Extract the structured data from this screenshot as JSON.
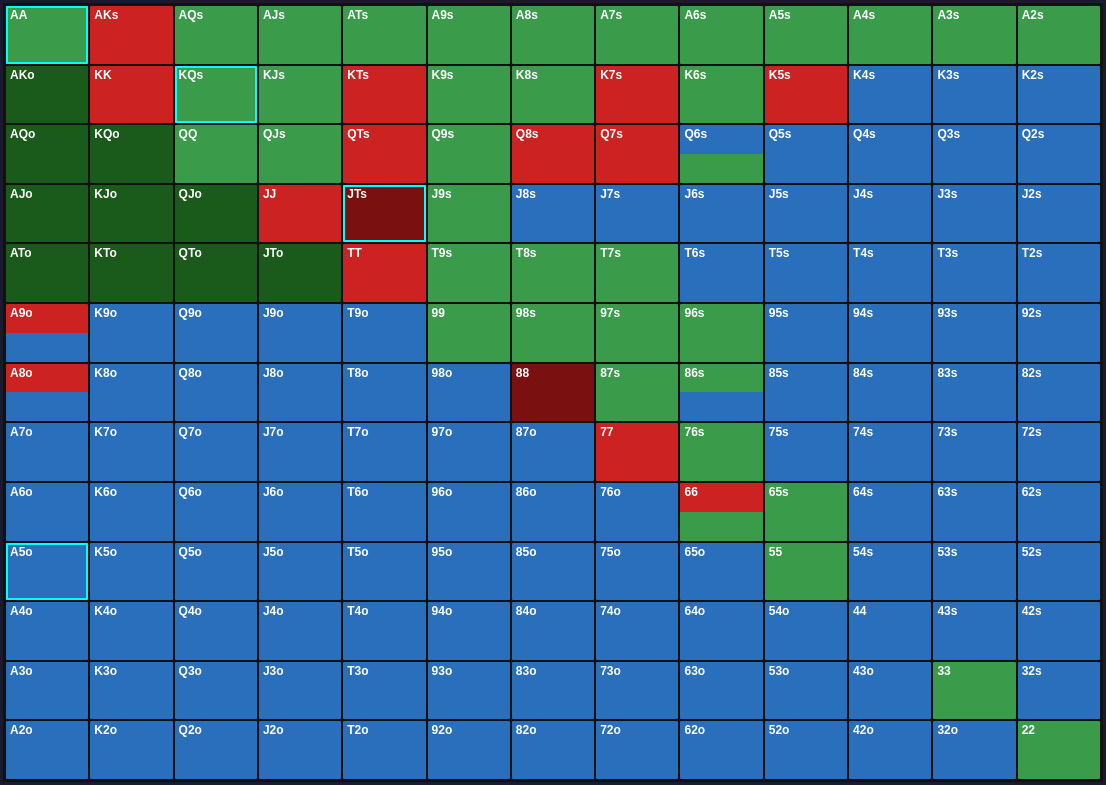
{
  "grid": {
    "cells": [
      {
        "label": "AA",
        "color": "green",
        "border": "cyan"
      },
      {
        "label": "AKs",
        "color": "red",
        "border": ""
      },
      {
        "label": "AQs",
        "color": "green",
        "border": ""
      },
      {
        "label": "AJs",
        "color": "green",
        "border": ""
      },
      {
        "label": "ATs",
        "color": "green",
        "border": ""
      },
      {
        "label": "A9s",
        "color": "green",
        "border": ""
      },
      {
        "label": "A8s",
        "color": "green",
        "border": ""
      },
      {
        "label": "A7s",
        "color": "green",
        "border": ""
      },
      {
        "label": "A6s",
        "color": "green",
        "border": ""
      },
      {
        "label": "A5s",
        "color": "green",
        "border": ""
      },
      {
        "label": "A4s",
        "color": "green",
        "border": ""
      },
      {
        "label": "A3s",
        "color": "green",
        "border": ""
      },
      {
        "label": "A2s",
        "color": "green",
        "border": ""
      },
      {
        "label": "AKo",
        "color": "dark-green",
        "border": ""
      },
      {
        "label": "KK",
        "color": "red",
        "border": ""
      },
      {
        "label": "KQs",
        "color": "green",
        "border": "cyan"
      },
      {
        "label": "KJs",
        "color": "green",
        "border": ""
      },
      {
        "label": "KTs",
        "color": "red",
        "border": ""
      },
      {
        "label": "K9s",
        "color": "green",
        "border": ""
      },
      {
        "label": "K8s",
        "color": "green",
        "border": ""
      },
      {
        "label": "K7s",
        "color": "red",
        "border": ""
      },
      {
        "label": "K6s",
        "color": "green",
        "border": ""
      },
      {
        "label": "K5s",
        "color": "red",
        "border": ""
      },
      {
        "label": "K4s",
        "color": "blue",
        "border": ""
      },
      {
        "label": "K3s",
        "color": "blue",
        "border": ""
      },
      {
        "label": "K2s",
        "color": "blue",
        "border": ""
      },
      {
        "label": "AQo",
        "color": "dark-green",
        "border": ""
      },
      {
        "label": "KQo",
        "color": "dark-green",
        "border": ""
      },
      {
        "label": "QQ",
        "color": "green",
        "border": ""
      },
      {
        "label": "QJs",
        "color": "green",
        "border": ""
      },
      {
        "label": "QTs",
        "color": "red",
        "border": ""
      },
      {
        "label": "Q9s",
        "color": "green",
        "border": ""
      },
      {
        "label": "Q8s",
        "color": "red",
        "border": ""
      },
      {
        "label": "Q7s",
        "color": "red",
        "border": ""
      },
      {
        "label": "Q6s",
        "color": "split-blue-green",
        "border": ""
      },
      {
        "label": "Q5s",
        "color": "blue",
        "border": ""
      },
      {
        "label": "Q4s",
        "color": "blue",
        "border": ""
      },
      {
        "label": "Q3s",
        "color": "blue",
        "border": ""
      },
      {
        "label": "Q2s",
        "color": "blue",
        "border": ""
      },
      {
        "label": "AJo",
        "color": "dark-green",
        "border": ""
      },
      {
        "label": "KJo",
        "color": "dark-green",
        "border": ""
      },
      {
        "label": "QJo",
        "color": "dark-green",
        "border": ""
      },
      {
        "label": "JJ",
        "color": "red",
        "border": ""
      },
      {
        "label": "JTs",
        "color": "dark-red",
        "border": "cyan"
      },
      {
        "label": "J9s",
        "color": "green",
        "border": ""
      },
      {
        "label": "J8s",
        "color": "blue",
        "border": ""
      },
      {
        "label": "J7s",
        "color": "blue",
        "border": ""
      },
      {
        "label": "J6s",
        "color": "blue",
        "border": ""
      },
      {
        "label": "J5s",
        "color": "blue",
        "border": ""
      },
      {
        "label": "J4s",
        "color": "blue",
        "border": ""
      },
      {
        "label": "J3s",
        "color": "blue",
        "border": ""
      },
      {
        "label": "J2s",
        "color": "blue",
        "border": ""
      },
      {
        "label": "ATo",
        "color": "dark-green",
        "border": ""
      },
      {
        "label": "KTo",
        "color": "dark-green",
        "border": ""
      },
      {
        "label": "QTo",
        "color": "dark-green",
        "border": ""
      },
      {
        "label": "JTo",
        "color": "dark-green",
        "border": ""
      },
      {
        "label": "TT",
        "color": "red",
        "border": ""
      },
      {
        "label": "T9s",
        "color": "green",
        "border": ""
      },
      {
        "label": "T8s",
        "color": "green",
        "border": ""
      },
      {
        "label": "T7s",
        "color": "green",
        "border": ""
      },
      {
        "label": "T6s",
        "color": "blue",
        "border": ""
      },
      {
        "label": "T5s",
        "color": "blue",
        "border": ""
      },
      {
        "label": "T4s",
        "color": "blue",
        "border": ""
      },
      {
        "label": "T3s",
        "color": "blue",
        "border": ""
      },
      {
        "label": "T2s",
        "color": "blue",
        "border": ""
      },
      {
        "label": "A9o",
        "color": "split-red-blue",
        "border": ""
      },
      {
        "label": "K9o",
        "color": "blue",
        "border": ""
      },
      {
        "label": "Q9o",
        "color": "blue",
        "border": ""
      },
      {
        "label": "J9o",
        "color": "blue",
        "border": ""
      },
      {
        "label": "T9o",
        "color": "blue",
        "border": ""
      },
      {
        "label": "99",
        "color": "green",
        "border": ""
      },
      {
        "label": "98s",
        "color": "green",
        "border": ""
      },
      {
        "label": "97s",
        "color": "green",
        "border": ""
      },
      {
        "label": "96s",
        "color": "green",
        "border": ""
      },
      {
        "label": "95s",
        "color": "blue",
        "border": ""
      },
      {
        "label": "94s",
        "color": "blue",
        "border": ""
      },
      {
        "label": "93s",
        "color": "blue",
        "border": ""
      },
      {
        "label": "92s",
        "color": "blue",
        "border": ""
      },
      {
        "label": "A8o",
        "color": "split-red-blue",
        "border": ""
      },
      {
        "label": "K8o",
        "color": "blue",
        "border": ""
      },
      {
        "label": "Q8o",
        "color": "blue",
        "border": ""
      },
      {
        "label": "J8o",
        "color": "blue",
        "border": ""
      },
      {
        "label": "T8o",
        "color": "blue",
        "border": ""
      },
      {
        "label": "98o",
        "color": "blue",
        "border": ""
      },
      {
        "label": "88",
        "color": "dark-red",
        "border": ""
      },
      {
        "label": "87s",
        "color": "green",
        "border": ""
      },
      {
        "label": "86s",
        "color": "split-green-blue",
        "border": ""
      },
      {
        "label": "85s",
        "color": "blue",
        "border": ""
      },
      {
        "label": "84s",
        "color": "blue",
        "border": ""
      },
      {
        "label": "83s",
        "color": "blue",
        "border": ""
      },
      {
        "label": "82s",
        "color": "blue",
        "border": ""
      },
      {
        "label": "A7o",
        "color": "blue",
        "border": ""
      },
      {
        "label": "K7o",
        "color": "blue",
        "border": ""
      },
      {
        "label": "Q7o",
        "color": "blue",
        "border": ""
      },
      {
        "label": "J7o",
        "color": "blue",
        "border": ""
      },
      {
        "label": "T7o",
        "color": "blue",
        "border": ""
      },
      {
        "label": "97o",
        "color": "blue",
        "border": ""
      },
      {
        "label": "87o",
        "color": "blue",
        "border": ""
      },
      {
        "label": "77",
        "color": "red",
        "border": ""
      },
      {
        "label": "76s",
        "color": "green",
        "border": ""
      },
      {
        "label": "75s",
        "color": "blue",
        "border": ""
      },
      {
        "label": "74s",
        "color": "blue",
        "border": ""
      },
      {
        "label": "73s",
        "color": "blue",
        "border": ""
      },
      {
        "label": "72s",
        "color": "blue",
        "border": ""
      },
      {
        "label": "A6o",
        "color": "blue",
        "border": ""
      },
      {
        "label": "K6o",
        "color": "blue",
        "border": ""
      },
      {
        "label": "Q6o",
        "color": "blue",
        "border": ""
      },
      {
        "label": "J6o",
        "color": "blue",
        "border": ""
      },
      {
        "label": "T6o",
        "color": "blue",
        "border": ""
      },
      {
        "label": "96o",
        "color": "blue",
        "border": ""
      },
      {
        "label": "86o",
        "color": "blue",
        "border": ""
      },
      {
        "label": "76o",
        "color": "blue",
        "border": ""
      },
      {
        "label": "66",
        "color": "split-red-green",
        "border": ""
      },
      {
        "label": "65s",
        "color": "green",
        "border": ""
      },
      {
        "label": "64s",
        "color": "blue",
        "border": ""
      },
      {
        "label": "63s",
        "color": "blue",
        "border": ""
      },
      {
        "label": "62s",
        "color": "blue",
        "border": ""
      },
      {
        "label": "A5o",
        "color": "blue",
        "border": "cyan"
      },
      {
        "label": "K5o",
        "color": "blue",
        "border": ""
      },
      {
        "label": "Q5o",
        "color": "blue",
        "border": ""
      },
      {
        "label": "J5o",
        "color": "blue",
        "border": ""
      },
      {
        "label": "T5o",
        "color": "blue",
        "border": ""
      },
      {
        "label": "95o",
        "color": "blue",
        "border": ""
      },
      {
        "label": "85o",
        "color": "blue",
        "border": ""
      },
      {
        "label": "75o",
        "color": "blue",
        "border": ""
      },
      {
        "label": "65o",
        "color": "blue",
        "border": ""
      },
      {
        "label": "55",
        "color": "green",
        "border": ""
      },
      {
        "label": "54s",
        "color": "blue",
        "border": ""
      },
      {
        "label": "53s",
        "color": "blue",
        "border": ""
      },
      {
        "label": "52s",
        "color": "blue",
        "border": ""
      },
      {
        "label": "A4o",
        "color": "blue",
        "border": ""
      },
      {
        "label": "K4o",
        "color": "blue",
        "border": ""
      },
      {
        "label": "Q4o",
        "color": "blue",
        "border": ""
      },
      {
        "label": "J4o",
        "color": "blue",
        "border": ""
      },
      {
        "label": "T4o",
        "color": "blue",
        "border": ""
      },
      {
        "label": "94o",
        "color": "blue",
        "border": ""
      },
      {
        "label": "84o",
        "color": "blue",
        "border": ""
      },
      {
        "label": "74o",
        "color": "blue",
        "border": ""
      },
      {
        "label": "64o",
        "color": "blue",
        "border": ""
      },
      {
        "label": "54o",
        "color": "blue",
        "border": ""
      },
      {
        "label": "44",
        "color": "blue",
        "border": ""
      },
      {
        "label": "43s",
        "color": "blue",
        "border": ""
      },
      {
        "label": "42s",
        "color": "blue",
        "border": ""
      },
      {
        "label": "A3o",
        "color": "blue",
        "border": ""
      },
      {
        "label": "K3o",
        "color": "blue",
        "border": ""
      },
      {
        "label": "Q3o",
        "color": "blue",
        "border": ""
      },
      {
        "label": "J3o",
        "color": "blue",
        "border": ""
      },
      {
        "label": "T3o",
        "color": "blue",
        "border": ""
      },
      {
        "label": "93o",
        "color": "blue",
        "border": ""
      },
      {
        "label": "83o",
        "color": "blue",
        "border": ""
      },
      {
        "label": "73o",
        "color": "blue",
        "border": ""
      },
      {
        "label": "63o",
        "color": "blue",
        "border": ""
      },
      {
        "label": "53o",
        "color": "blue",
        "border": ""
      },
      {
        "label": "43o",
        "color": "blue",
        "border": ""
      },
      {
        "label": "33",
        "color": "green",
        "border": ""
      },
      {
        "label": "32s",
        "color": "blue",
        "border": ""
      },
      {
        "label": "A2o",
        "color": "blue",
        "border": ""
      },
      {
        "label": "K2o",
        "color": "blue",
        "border": ""
      },
      {
        "label": "Q2o",
        "color": "blue",
        "border": ""
      },
      {
        "label": "J2o",
        "color": "blue",
        "border": ""
      },
      {
        "label": "T2o",
        "color": "blue",
        "border": ""
      },
      {
        "label": "92o",
        "color": "blue",
        "border": ""
      },
      {
        "label": "82o",
        "color": "blue",
        "border": ""
      },
      {
        "label": "72o",
        "color": "blue",
        "border": ""
      },
      {
        "label": "62o",
        "color": "blue",
        "border": ""
      },
      {
        "label": "52o",
        "color": "blue",
        "border": ""
      },
      {
        "label": "42o",
        "color": "blue",
        "border": ""
      },
      {
        "label": "32o",
        "color": "blue",
        "border": ""
      },
      {
        "label": "22",
        "color": "green",
        "border": ""
      }
    ]
  }
}
